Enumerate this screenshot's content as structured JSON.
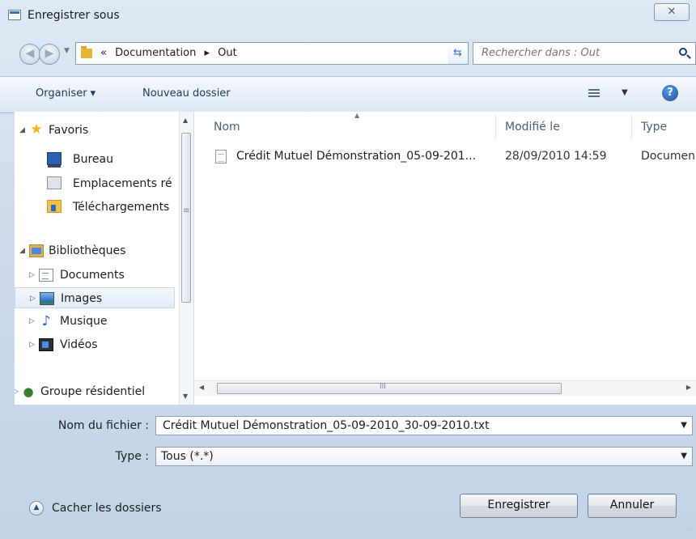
{
  "window": {
    "title": "Enregistrer sous",
    "close_glyph": "✕"
  },
  "address": {
    "prefix": "«",
    "crumbs": [
      "Documentation",
      "▸",
      "Out"
    ],
    "search_placeholder": "Rechercher dans : Out"
  },
  "toolbar": {
    "organiser": "Organiser ▾",
    "new_folder": "Nouveau dossier",
    "help": "?"
  },
  "nav": {
    "favorites": {
      "label": "Favoris",
      "items": [
        "Bureau",
        "Emplacements ré",
        "Téléchargements"
      ]
    },
    "libraries": {
      "label": "Bibliothèques",
      "items": [
        "Documents",
        "Images",
        "Musique",
        "Vidéos"
      ]
    },
    "homegroup": "Groupe résidentiel",
    "selected": "Images"
  },
  "columns": {
    "name": "Nom",
    "modified": "Modifié le",
    "type": "Type"
  },
  "files": [
    {
      "name": "Crédit Mutuel Démonstration_05-09-201...",
      "modified": "28/09/2010 14:59",
      "type": "Documen"
    }
  ],
  "hscroll_grip": "III",
  "form": {
    "filename_label": "Nom du fichier :",
    "filename_value": "Crédit Mutuel Démonstration_05-09-2010_30-09-2010.txt",
    "type_label": "Type :",
    "type_value": "Tous (*.*)"
  },
  "footer": {
    "hide_folders": "Cacher les dossiers",
    "save": "Enregistrer",
    "cancel": "Annuler"
  },
  "colors": {
    "accent": "#2f6fd8",
    "window_bg": "#cfdcec",
    "selection": "#e3ecf8"
  },
  "icons": [
    "window-icon",
    "back-arrow-icon",
    "forward-arrow-icon",
    "folder-icon",
    "refresh-icon",
    "search-icon",
    "view-list-icon",
    "help-icon",
    "star-icon",
    "desktop-icon",
    "recent-places-icon",
    "downloads-icon",
    "library-icon",
    "document-icon",
    "pictures-icon",
    "music-icon",
    "video-icon",
    "homegroup-icon",
    "text-file-icon",
    "chevron-up-icon"
  ]
}
